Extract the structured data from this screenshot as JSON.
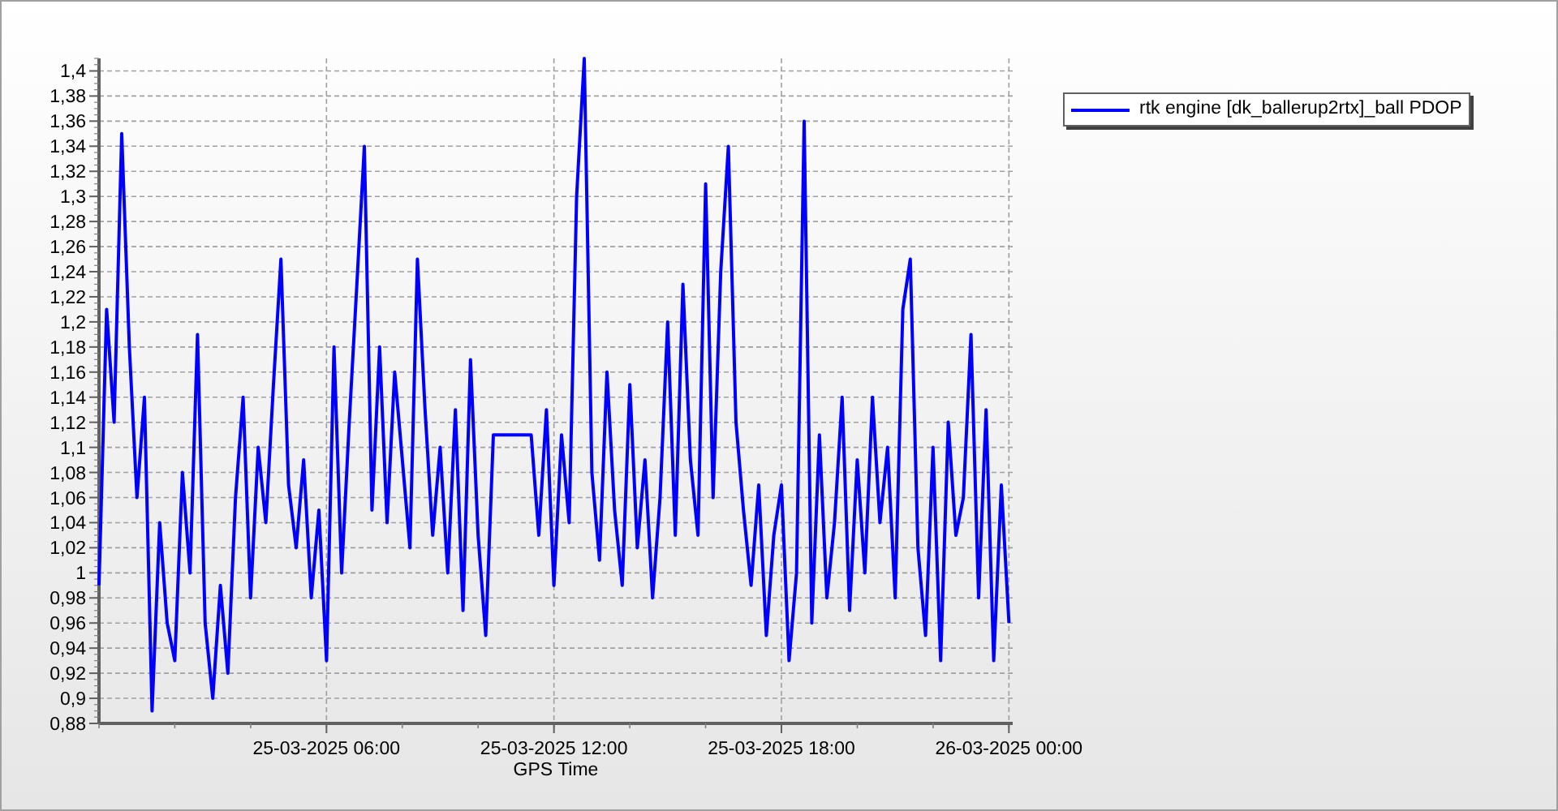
{
  "chart": {
    "chart_data": {
      "type": "line",
      "grid": true,
      "xlabel": "GPS Time",
      "ylim": [
        0.88,
        1.41
      ],
      "yticks": [
        {
          "value": 0.88,
          "label": "0,88"
        },
        {
          "value": 0.9,
          "label": "0,9"
        },
        {
          "value": 0.92,
          "label": "0,92"
        },
        {
          "value": 0.94,
          "label": "0,94"
        },
        {
          "value": 0.96,
          "label": "0,96"
        },
        {
          "value": 0.98,
          "label": "0,98"
        },
        {
          "value": 1,
          "label": "1"
        },
        {
          "value": 1.02,
          "label": "1,02"
        },
        {
          "value": 1.04,
          "label": "1,04"
        },
        {
          "value": 1.06,
          "label": "1,06"
        },
        {
          "value": 1.08,
          "label": "1,08"
        },
        {
          "value": 1.1,
          "label": "1,1"
        },
        {
          "value": 1.12,
          "label": "1,12"
        },
        {
          "value": 1.14,
          "label": "1,14"
        },
        {
          "value": 1.16,
          "label": "1,16"
        },
        {
          "value": 1.18,
          "label": "1,18"
        },
        {
          "value": 1.2,
          "label": "1,2"
        },
        {
          "value": 1.22,
          "label": "1,22"
        },
        {
          "value": 1.24,
          "label": "1,24"
        },
        {
          "value": 1.26,
          "label": "1,26"
        },
        {
          "value": 1.28,
          "label": "1,28"
        },
        {
          "value": 1.3,
          "label": "1,3"
        },
        {
          "value": 1.32,
          "label": "1,32"
        },
        {
          "value": 1.34,
          "label": "1,34"
        },
        {
          "value": 1.36,
          "label": "1,36"
        },
        {
          "value": 1.38,
          "label": "1,38"
        },
        {
          "value": 1.4,
          "label": "1,4"
        }
      ],
      "categories": [
        null,
        null,
        null,
        null,
        null,
        null,
        null,
        null,
        null,
        null,
        null,
        null,
        null,
        null,
        null,
        null,
        null,
        null,
        null,
        null,
        null,
        null,
        null,
        null,
        null,
        null,
        null,
        null,
        null,
        null,
        "25-03-2025 06:00",
        null,
        null,
        null,
        null,
        null,
        null,
        null,
        null,
        null,
        null,
        null,
        null,
        null,
        null,
        null,
        null,
        null,
        null,
        null,
        null,
        null,
        null,
        null,
        null,
        null,
        null,
        null,
        null,
        null,
        "25-03-2025 12:00",
        null,
        null,
        null,
        null,
        null,
        null,
        null,
        null,
        null,
        null,
        null,
        null,
        null,
        null,
        null,
        null,
        null,
        null,
        null,
        null,
        null,
        null,
        null,
        null,
        null,
        null,
        null,
        null,
        null,
        "25-03-2025 18:00",
        null,
        null,
        null,
        null,
        null,
        null,
        null,
        null,
        null,
        null,
        null,
        null,
        null,
        null,
        null,
        null,
        null,
        null,
        null,
        null,
        null,
        null,
        null,
        null,
        null,
        null,
        null,
        null,
        null,
        "26-03-2025 00:00"
      ],
      "series": [
        {
          "name": "rtk engine [dk_ballerup2rtx]_ball PDOP",
          "color": "#0000ff",
          "values": [
            0.99,
            1.21,
            1.12,
            1.35,
            1.18,
            1.06,
            1.14,
            0.89,
            1.04,
            0.96,
            0.93,
            1.08,
            1.0,
            1.19,
            0.96,
            0.9,
            0.99,
            0.92,
            1.06,
            1.14,
            0.98,
            1.1,
            1.04,
            1.15,
            1.25,
            1.07,
            1.02,
            1.09,
            0.98,
            1.05,
            0.93,
            1.18,
            1.0,
            1.12,
            1.23,
            1.34,
            1.05,
            1.18,
            1.04,
            1.16,
            1.09,
            1.02,
            1.25,
            1.13,
            1.03,
            1.1,
            1.0,
            1.13,
            0.97,
            1.17,
            1.03,
            0.95,
            1.11,
            1.11,
            1.11,
            1.11,
            1.11,
            1.11,
            1.03,
            1.13,
            0.99,
            1.11,
            1.04,
            1.3,
            1.41,
            1.08,
            1.01,
            1.16,
            1.05,
            0.99,
            1.15,
            1.02,
            1.09,
            0.98,
            1.06,
            1.2,
            1.03,
            1.23,
            1.09,
            1.03,
            1.31,
            1.06,
            1.24,
            1.34,
            1.12,
            1.05,
            0.99,
            1.07,
            0.95,
            1.03,
            1.07,
            0.93,
            1.0,
            1.36,
            0.96,
            1.11,
            0.98,
            1.04,
            1.14,
            0.97,
            1.09,
            1.0,
            1.14,
            1.04,
            1.1,
            0.98,
            1.21,
            1.25,
            1.02,
            0.95,
            1.1,
            0.93,
            1.12,
            1.03,
            1.06,
            1.19,
            0.98,
            1.13,
            0.93,
            1.07,
            0.96
          ]
        }
      ]
    }
  }
}
